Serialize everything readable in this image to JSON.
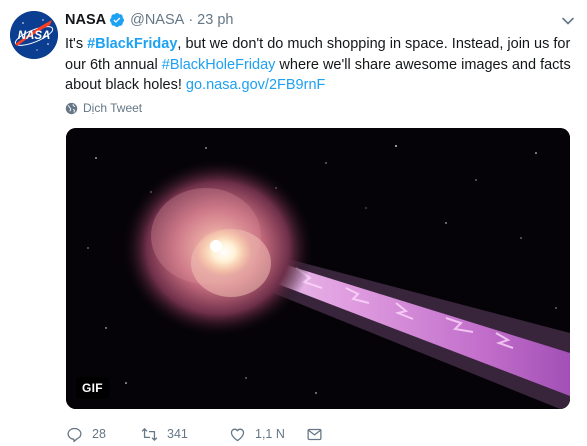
{
  "tweet": {
    "author_name": "NASA",
    "handle": "@NASA",
    "separator": "·",
    "time": "23 ph",
    "text": {
      "l1_a": "It's ",
      "l1_tag": "#BlackFriday",
      "l1_b": ", but we don't do much shopping in space. Instead, join us for",
      "l2_a": "our 6th annual ",
      "l2_tag": "#BlackHoleFriday",
      "l2_b": " where we'll share awesome images and facts",
      "l3_a": "about black holes! ",
      "l3_link": "go.nasa.gov/2FB9rnF"
    },
    "translate_label": "Dịch Tweet",
    "media_badge": "GIF",
    "actions": {
      "reply_count": "28",
      "retweet_count": "341",
      "like_count": "1,1 N"
    }
  },
  "icons": {
    "avatar": "nasa-logo",
    "verified": "verified-badge-icon",
    "caret": "chevron-down-icon",
    "translate": "globe-icon",
    "reply": "reply-icon",
    "retweet": "retweet-icon",
    "like": "heart-icon",
    "dm": "envelope-icon"
  },
  "colors": {
    "link": "#1da1f2",
    "secondary_text": "#657786",
    "primary_text": "#14171a",
    "nasa_blue": "#0b3d91",
    "nasa_red": "#fc3d21"
  }
}
